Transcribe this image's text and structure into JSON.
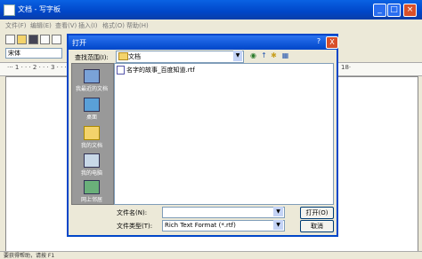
{
  "app": {
    "title": "文档 - 写字板",
    "menu": [
      "文件(F)",
      "编辑(E)",
      "查看(V)",
      "插入(I)",
      "格式(O)",
      "帮助(H)"
    ],
    "font_name": "宋体",
    "ruler_text": "··· 1 · · · 2 · · · 3 · · · 4 · · · 5 · · · 6",
    "ruler_right": "18·",
    "status": "要获得帮助，请按 F1"
  },
  "dialog": {
    "title": "打开",
    "help": "?",
    "close": "X",
    "look_in_label": "查找范围(I):",
    "look_in_value": "文档",
    "places": [
      {
        "label": "我最近的文档",
        "icon": "recent-documents-icon"
      },
      {
        "label": "桌面",
        "icon": "desktop-icon"
      },
      {
        "label": "我的文档",
        "icon": "my-documents-icon"
      },
      {
        "label": "我的电脑",
        "icon": "my-computer-icon"
      },
      {
        "label": "网上邻居",
        "icon": "network-places-icon"
      }
    ],
    "files": [
      "名字的故事_百度知道.rtf"
    ],
    "file_name_label": "文件名(N):",
    "file_name_value": "",
    "file_type_label": "文件类型(T):",
    "file_type_value": "Rich Text Format (*.rtf)",
    "open_button": "打开(O)",
    "cancel_button": "取消"
  },
  "colors": {
    "titlebar": "#0046c8",
    "close_button": "#d8502a",
    "places_bar": "#999999"
  }
}
